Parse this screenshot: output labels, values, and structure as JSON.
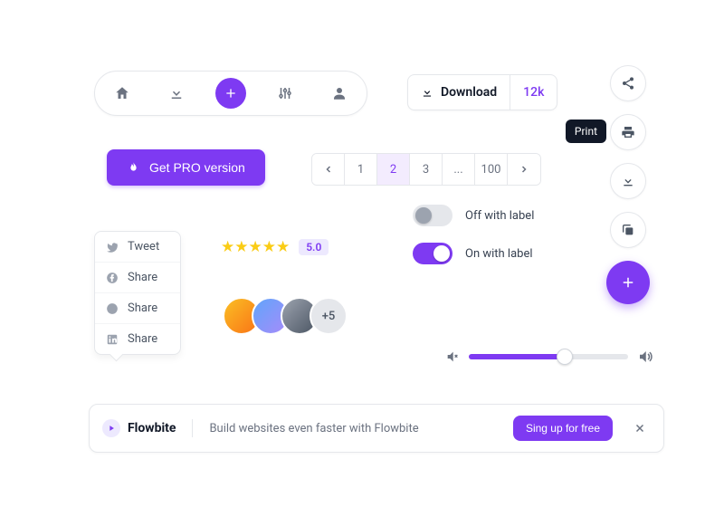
{
  "nav": {
    "items": [
      "home",
      "download",
      "plus",
      "sliders",
      "user"
    ]
  },
  "download_button": {
    "label": "Download",
    "count": "12k"
  },
  "rail": {
    "tooltip": "Print",
    "items": [
      "share",
      "print",
      "download",
      "copy",
      "plus"
    ]
  },
  "pro_button": {
    "label": "Get PRO version"
  },
  "pagination": {
    "pages": [
      "1",
      "2",
      "3",
      "...",
      "100"
    ],
    "active_index": 1
  },
  "share": {
    "items": [
      {
        "icon": "twitter",
        "label": "Tweet"
      },
      {
        "icon": "facebook",
        "label": "Share"
      },
      {
        "icon": "reddit",
        "label": "Share"
      },
      {
        "icon": "linkedin",
        "label": "Share"
      }
    ]
  },
  "rating": {
    "stars": 5,
    "value": "5.0"
  },
  "avatars": {
    "extra": "+5"
  },
  "toggles": {
    "off_label": "Off with label",
    "on_label": "On with label"
  },
  "slider": {
    "percent": 60
  },
  "banner": {
    "brand": "Flowbite",
    "text": "Build websites even faster with Flowbite",
    "cta": "Sing up for free"
  }
}
